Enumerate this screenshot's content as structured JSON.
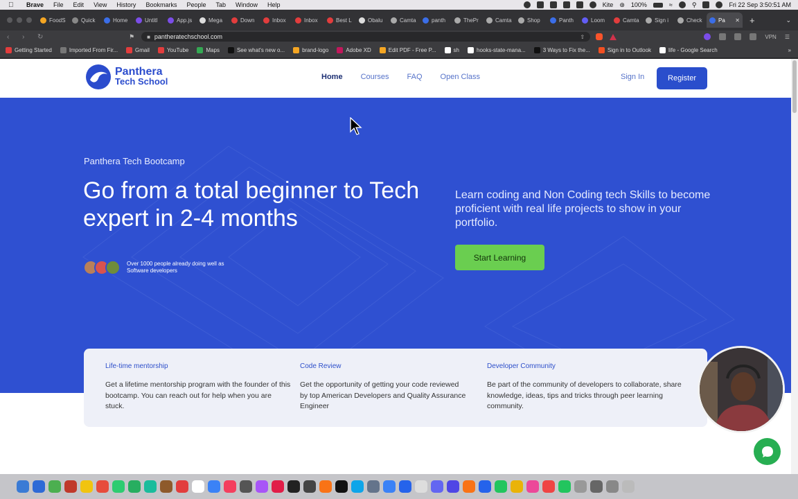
{
  "menubar": {
    "items": [
      "Brave",
      "File",
      "Edit",
      "View",
      "History",
      "Bookmarks",
      "People",
      "Tab",
      "Window",
      "Help"
    ],
    "status_app": "Kite",
    "battery": "100%",
    "clock": "Fri 22 Sep 3:50:51 AM"
  },
  "tabs": [
    {
      "label": "FoodS",
      "color": "#f5a623"
    },
    {
      "label": "Quick",
      "color": "#888"
    },
    {
      "label": "Home",
      "color": "#3b6ee8"
    },
    {
      "label": "Untitl",
      "color": "#7b4de8"
    },
    {
      "label": "App.js",
      "color": "#7b4de8"
    },
    {
      "label": "Mega",
      "color": "#ddd"
    },
    {
      "label": "Down",
      "color": "#e23d3d"
    },
    {
      "label": "Inbox",
      "color": "#e23d3d"
    },
    {
      "label": "Inbox",
      "color": "#e23d3d"
    },
    {
      "label": "Best L",
      "color": "#e23d3d"
    },
    {
      "label": "Obalu",
      "color": "#ddd"
    },
    {
      "label": "Camta",
      "color": "#aaa"
    },
    {
      "label": "panth",
      "color": "#3b6ee8"
    },
    {
      "label": "ThePr",
      "color": "#aaa"
    },
    {
      "label": "Camta",
      "color": "#aaa"
    },
    {
      "label": "Shop",
      "color": "#aaa"
    },
    {
      "label": "Panth",
      "color": "#3b6ee8"
    },
    {
      "label": "Loom",
      "color": "#625df5"
    },
    {
      "label": "Camta",
      "color": "#e23d3d"
    },
    {
      "label": "Sign i",
      "color": "#aaa"
    },
    {
      "label": "Check",
      "color": "#aaa"
    },
    {
      "label": "Pa",
      "color": "#3b6ee8",
      "active": true
    }
  ],
  "address": {
    "url": "pantheratechschool.com",
    "vpn": "VPN"
  },
  "bookmarks": [
    {
      "label": "Getting Started",
      "color": "#e23d3d"
    },
    {
      "label": "Imported From Fir...",
      "color": "#777"
    },
    {
      "label": "Gmail",
      "color": "#e23d3d"
    },
    {
      "label": "YouTube",
      "color": "#e23d3d"
    },
    {
      "label": "Maps",
      "color": "#34a853"
    },
    {
      "label": "See what's new o...",
      "color": "#111"
    },
    {
      "label": "brand-logo",
      "color": "#f5a623"
    },
    {
      "label": "Adobe XD",
      "color": "#c2185b"
    },
    {
      "label": "Edit PDF - Free P...",
      "color": "#f5a623"
    },
    {
      "label": "sh",
      "color": "#fff"
    },
    {
      "label": "hooks-state-mana...",
      "color": "#fff"
    },
    {
      "label": "3 Ways to Fix the...",
      "color": "#111"
    },
    {
      "label": "Sign in to Outlook",
      "color": "#f25022"
    },
    {
      "label": "life - Google Search",
      "color": "#fff"
    }
  ],
  "site": {
    "logo_line1": "Panthera",
    "logo_line2": "Tech School",
    "nav": [
      {
        "label": "Home",
        "active": true
      },
      {
        "label": "Courses"
      },
      {
        "label": "FAQ"
      },
      {
        "label": "Open Class"
      }
    ],
    "sign_in": "Sign In",
    "register": "Register"
  },
  "hero": {
    "eyebrow": "Panthera Tech Bootcamp",
    "headline": "Go from a total beginner to Tech expert in 2-4 months",
    "social_proof": "Over 1000 people already doing well as Software developers",
    "subtitle": "Learn coding and Non Coding tech Skills to become proficient with real life projects to show in your portfolio.",
    "cta": "Start Learning"
  },
  "features": [
    {
      "title": "Life-time mentorship",
      "body": "Get a lifetime mentorship program with the founder of this bootcamp. You can reach out for help when you are stuck."
    },
    {
      "title": "Code Review",
      "body": "Get the opportunity of getting your code reviewed by top American Developers and Quality Assurance Engineer"
    },
    {
      "title": "Developer Community",
      "body": "Be part of the community of developers to collaborate, share knowledge, ideas, tips and tricks through peer learning community."
    }
  ],
  "colors": {
    "brand": "#2a4ecc",
    "hero_bg": "#2f50d1",
    "cta_green": "#6ace50",
    "chat_green": "#27ae52"
  }
}
